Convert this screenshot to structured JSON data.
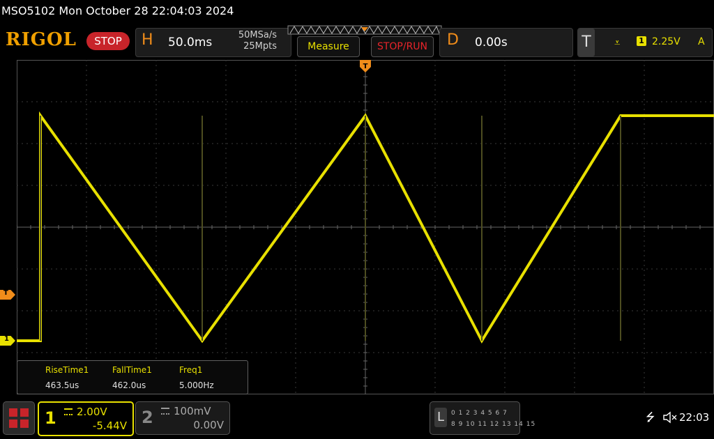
{
  "titlebar": {
    "text": "MSO5102  Mon October 28 22:04:03 2024"
  },
  "header": {
    "logo": "RIGOL",
    "run_state": "STOP",
    "horizontal": {
      "letter": "H",
      "timebase": "50.0ms",
      "sample_rate": "50MSa/s",
      "memory_depth": "25Mpts"
    },
    "buttons": {
      "measure": "Measure",
      "stop_run": "STOP/RUN"
    },
    "delay": {
      "letter": "D",
      "value": "0.00s"
    },
    "trigger": {
      "letter": "T",
      "source": "1",
      "level": "2.25V",
      "mode": "A"
    }
  },
  "markers": {
    "trigger_level": "T",
    "channel1": "1"
  },
  "measurements": [
    {
      "name": "RiseTime1",
      "value": "463.5us"
    },
    {
      "name": "FallTime1",
      "value": "462.0us"
    },
    {
      "name": "Freq1",
      "value": "5.000Hz"
    }
  ],
  "channels": {
    "ch1": {
      "number": "1",
      "scale": "2.00V",
      "offset": "-5.44V"
    },
    "ch2": {
      "number": "2",
      "scale": "100mV",
      "offset": "0.00V"
    }
  },
  "logic": {
    "letter": "L",
    "row1": "0 1 2 3  4 5 6 7",
    "row2": "8 9 10 11 12 13 14 15"
  },
  "status": {
    "time": "22:03"
  },
  "colors": {
    "ch1": "#e8e000",
    "accent": "#f08c1a",
    "stop": "#c8242a"
  }
}
